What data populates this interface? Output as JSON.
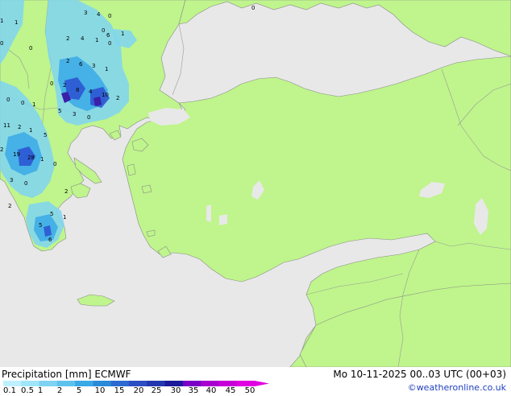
{
  "map": {
    "sea_color": "#e8e8e8",
    "land_color": "#bff58c",
    "border_color": "#9a9a9a",
    "precip_light": "#7fd3f2",
    "precip_mid": "#3aa9e6",
    "precip_heavy": "#2c56d2",
    "precip_peak": "#3a1fa8",
    "station_values": [
      {
        "label": "3"
      },
      {
        "label": "4"
      },
      {
        "label": "0"
      },
      {
        "label": "1"
      },
      {
        "label": "1"
      },
      {
        "label": "2"
      },
      {
        "label": "4"
      },
      {
        "label": "1"
      },
      {
        "label": "0"
      },
      {
        "label": "2"
      },
      {
        "label": "6"
      },
      {
        "label": "3"
      },
      {
        "label": "1"
      },
      {
        "label": "0"
      },
      {
        "label": "0"
      },
      {
        "label": "2"
      },
      {
        "label": "8"
      },
      {
        "label": "4"
      },
      {
        "label": "10"
      },
      {
        "label": "2"
      },
      {
        "label": "0"
      },
      {
        "label": "0"
      },
      {
        "label": "1"
      },
      {
        "label": "5"
      },
      {
        "label": "3"
      },
      {
        "label": "0"
      },
      {
        "label": "11"
      },
      {
        "label": "2"
      },
      {
        "label": "1"
      },
      {
        "label": "5"
      },
      {
        "label": "2"
      },
      {
        "label": "19"
      },
      {
        "label": "28"
      },
      {
        "label": "1"
      },
      {
        "label": "0"
      },
      {
        "label": "3"
      },
      {
        "label": "0"
      },
      {
        "label": "2"
      },
      {
        "label": "2"
      },
      {
        "label": "5"
      },
      {
        "label": "1"
      },
      {
        "label": "5"
      },
      {
        "label": "6"
      },
      {
        "label": "0"
      },
      {
        "label": "0"
      },
      {
        "label": "1"
      },
      {
        "label": "6"
      },
      {
        "label": "0"
      }
    ]
  },
  "footer": {
    "title": "Precipitation [mm]  ECMWF",
    "datetime": "Mo 10-11-2025 00..03 UTC (00+03)",
    "credit": "©weatheronline.co.uk",
    "scale": {
      "labels": [
        "0.1",
        "0.5",
        "1",
        "2",
        "5",
        "10",
        "15",
        "20",
        "25",
        "30",
        "35",
        "40",
        "45",
        "50"
      ],
      "colors": [
        "#bff0ff",
        "#9fe6fa",
        "#7fd3f2",
        "#5ec2ee",
        "#3aa9e6",
        "#2b8ad8",
        "#2c6ad2",
        "#2c4ec4",
        "#2436ae",
        "#1a1a9a",
        "#7a00c8",
        "#a800d0",
        "#c800d8",
        "#e000e0"
      ]
    }
  }
}
